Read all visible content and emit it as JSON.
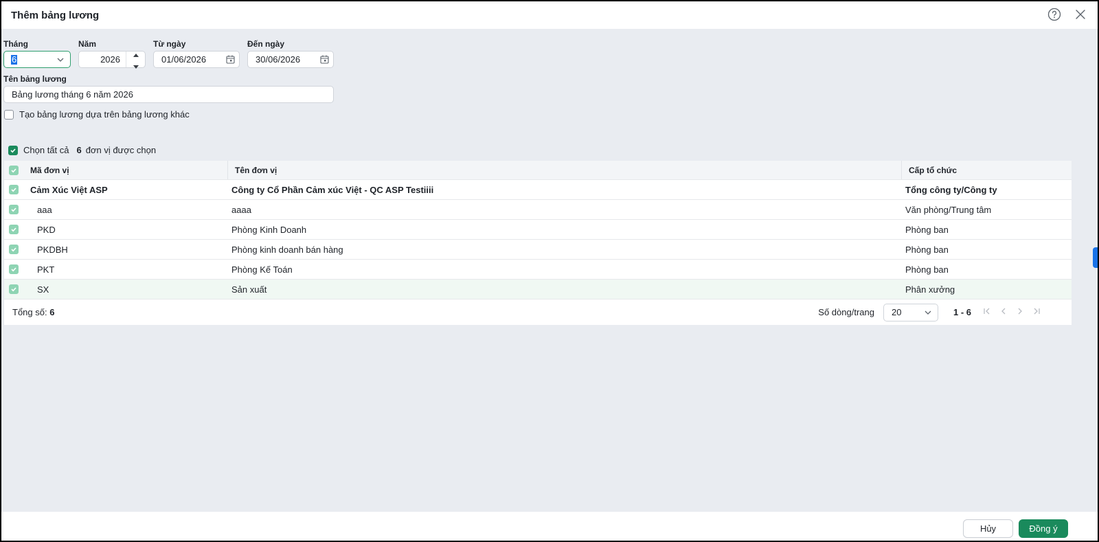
{
  "header": {
    "title": "Thêm bảng lương"
  },
  "form": {
    "month_label": "Tháng",
    "month_value": "6",
    "year_label": "Năm",
    "year_value": "2026",
    "from_label": "Từ ngày",
    "from_value": "01/06/2026",
    "to_label": "Đến ngày",
    "to_value": "30/06/2026",
    "name_label": "Tên bảng lương",
    "name_value": "Bảng lương tháng 6 năm 2026",
    "copy_checkbox_label": "Tạo bảng lương dựa trên bảng lương khác"
  },
  "selection": {
    "select_all_label": "Chọn tất cả",
    "count": "6",
    "count_suffix": "đơn vị được chọn"
  },
  "table": {
    "columns": [
      "Mã đơn vị",
      "Tên đơn vị",
      "Cấp tổ chức"
    ],
    "rows": [
      {
        "code": "Cảm Xúc Việt ASP",
        "name": "Công ty Cổ Phần Cảm xúc Việt - QC ASP Testiiii",
        "level": "Tổng công ty/Công ty"
      },
      {
        "code": "aaa",
        "name": "aaaa",
        "level": "Văn phòng/Trung tâm"
      },
      {
        "code": "PKD",
        "name": "Phòng Kinh Doanh",
        "level": "Phòng ban"
      },
      {
        "code": "PKDBH",
        "name": "Phòng kinh doanh bán hàng",
        "level": "Phòng ban"
      },
      {
        "code": "PKT",
        "name": "Phòng Kế Toán",
        "level": "Phòng ban"
      },
      {
        "code": "SX",
        "name": "Sản xuất",
        "level": "Phân xưởng"
      }
    ]
  },
  "pagination": {
    "total_label": "Tổng số:",
    "total_value": "6",
    "page_size_label": "Số dòng/trang",
    "page_size_value": "20",
    "range": "1 - 6"
  },
  "footer": {
    "cancel_label": "Hủy",
    "ok_label": "Đồng ý"
  },
  "colors": {
    "primary": "#1a8a5c",
    "accent_blue": "#1a73e8"
  }
}
